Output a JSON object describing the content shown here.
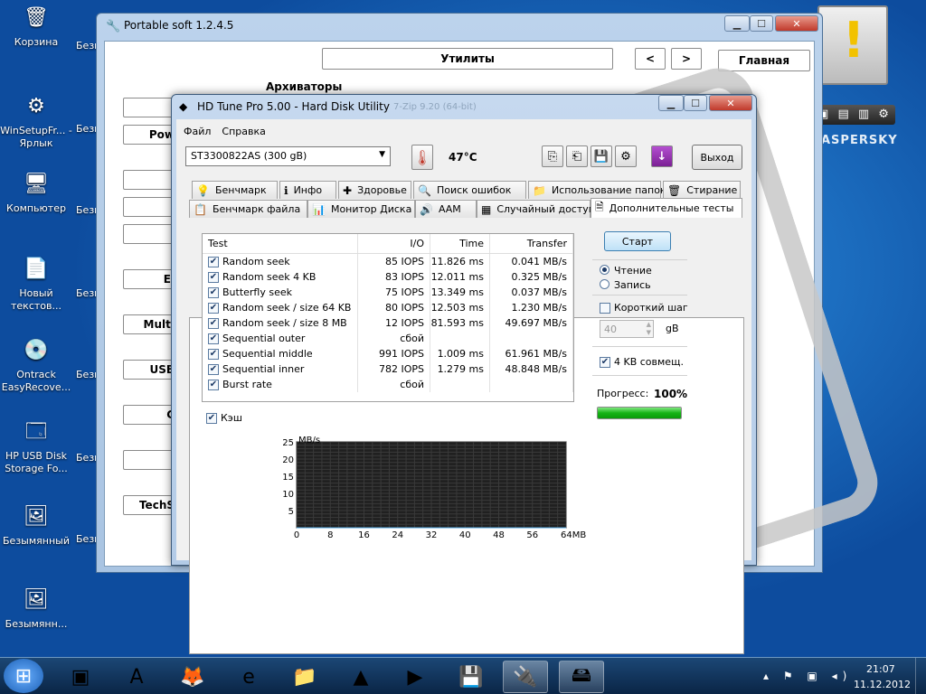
{
  "desktop": {
    "icons": [
      {
        "label": "Корзина",
        "icon": "recycle-bin-icon",
        "glyph": "🗑"
      },
      {
        "label": "WinSetupFr... - Ярлык",
        "icon": "shortcut-icon",
        "glyph": "⚙"
      },
      {
        "label": "Компьютер",
        "icon": "computer-icon",
        "glyph": "🖥"
      },
      {
        "label": "Новый текстов...",
        "icon": "text-file-icon",
        "glyph": "📄"
      },
      {
        "label": "Ontrack EasyRecove...",
        "icon": "recovery-icon",
        "glyph": "💿"
      },
      {
        "label": "HP USB Disk Storage Fo...",
        "icon": "usb-format-icon",
        "glyph": "🗔"
      },
      {
        "label": "Безымянный",
        "icon": "image-file-icon",
        "glyph": "🖼"
      },
      {
        "label": "Безымянн...",
        "icon": "image-file-icon",
        "glyph": "🖼"
      }
    ],
    "cut_labels": [
      "Безы",
      "Безы",
      "Безы",
      "Безы",
      "Безы",
      "Безы",
      "Безы"
    ],
    "kaspersky_text": "ASPERSKY"
  },
  "portable": {
    "title": "Portable soft 1.2.4.5",
    "utilities": "Утилиты",
    "prev": "<",
    "next": ">",
    "home": "Главная",
    "section": "Архиваторы",
    "side_buttons": [
      "",
      "Pow",
      "",
      "",
      "",
      "El",
      "Multi",
      "USB",
      "C",
      "",
      "TechS"
    ]
  },
  "hdtune": {
    "title": "HD Tune Pro 5.00 - Hard Disk Utility",
    "ghost_title": "7-Zip 9.20 (64-bit)",
    "menu": [
      "Файл",
      "Справка"
    ],
    "drive": "ST3300822AS (300 gB)",
    "temperature": "47°C",
    "exit": "Выход",
    "tabs_top": [
      {
        "label": "Бенчмарк",
        "icon": "benchmark-icon",
        "glyph": "💡"
      },
      {
        "label": "Инфо",
        "icon": "info-icon",
        "glyph": "ℹ"
      },
      {
        "label": "Здоровье",
        "icon": "health-icon",
        "glyph": "✚"
      },
      {
        "label": "Поиск ошибок",
        "icon": "error-scan-icon",
        "glyph": "🔍"
      },
      {
        "label": "Использование папок",
        "icon": "folder-usage-icon",
        "glyph": "📁"
      },
      {
        "label": "Стирание",
        "icon": "erase-icon",
        "glyph": "🗑"
      }
    ],
    "tabs_bottom": [
      {
        "label": "Бенчмарк файла",
        "icon": "file-benchmark-icon",
        "glyph": "📋"
      },
      {
        "label": "Монитор Диска",
        "icon": "disk-monitor-icon",
        "glyph": "📊"
      },
      {
        "label": "AAM",
        "icon": "aam-icon",
        "glyph": "🔊"
      },
      {
        "label": "Случайный доступ",
        "icon": "random-access-icon",
        "glyph": "▦"
      },
      {
        "label": "Дополнительные тесты",
        "icon": "extra-tests-icon",
        "glyph": "🗎"
      }
    ],
    "table": {
      "headers": [
        "Test",
        "I/O",
        "Time",
        "Transfer"
      ],
      "rows": [
        {
          "test": "Random seek",
          "io": "85 IOPS",
          "time": "11.826 ms",
          "transfer": "0.041 MB/s"
        },
        {
          "test": "Random seek 4 KB",
          "io": "83 IOPS",
          "time": "12.011 ms",
          "transfer": "0.325 MB/s"
        },
        {
          "test": "Butterfly seek",
          "io": "75 IOPS",
          "time": "13.349 ms",
          "transfer": "0.037 MB/s"
        },
        {
          "test": "Random seek / size 64 KB",
          "io": "80 IOPS",
          "time": "12.503 ms",
          "transfer": "1.230 MB/s"
        },
        {
          "test": "Random seek / size 8 MB",
          "io": "12 IOPS",
          "time": "81.593 ms",
          "transfer": "49.697 MB/s"
        },
        {
          "test": "Sequential outer",
          "io": "сбой",
          "time": "",
          "transfer": ""
        },
        {
          "test": "Sequential middle",
          "io": "991 IOPS",
          "time": "1.009 ms",
          "transfer": "61.961 MB/s"
        },
        {
          "test": "Sequential inner",
          "io": "782 IOPS",
          "time": "1.279 ms",
          "transfer": "48.848 MB/s"
        },
        {
          "test": "Burst rate",
          "io": "сбой",
          "time": "",
          "transfer": ""
        }
      ]
    },
    "cache_label": "Кэш",
    "start": "Старт",
    "read": "Чтение",
    "write": "Запись",
    "short_stroke": "Короткий шаг",
    "short_value": "40",
    "unit_gb": "gB",
    "align_4kb": "4 KB совмещ.",
    "progress_label": "Прогресс:",
    "progress_value": "100%",
    "progress_fraction": 1.0
  },
  "chart_data": {
    "type": "line",
    "ylabel": "MB/s",
    "xlabel": "MB",
    "ylim": [
      0,
      25
    ],
    "xlim": [
      0,
      64
    ],
    "yticks": [
      "25",
      "20",
      "15",
      "10",
      "5"
    ],
    "xticks": [
      "0",
      "8",
      "16",
      "24",
      "32",
      "40",
      "48",
      "56",
      "64MB"
    ],
    "series": [],
    "grid": true
  },
  "taskbar": {
    "items": [
      {
        "icon": "start-orb-icon",
        "glyph": "⊞"
      },
      {
        "icon": "screenshot-tool-icon",
        "glyph": "▣"
      },
      {
        "icon": "autocad-icon",
        "glyph": "A"
      },
      {
        "icon": "firefox-icon",
        "glyph": "🦊"
      },
      {
        "icon": "internet-explorer-icon",
        "glyph": "e"
      },
      {
        "icon": "explorer-folder-icon",
        "glyph": "📁"
      },
      {
        "icon": "vlc-icon",
        "glyph": "▲"
      },
      {
        "icon": "media-player-icon",
        "glyph": "▶"
      },
      {
        "icon": "floppy-icon",
        "glyph": "💾"
      },
      {
        "icon": "usb-drive-icon",
        "glyph": "🔌"
      },
      {
        "icon": "hard-disk-icon",
        "glyph": "🖴"
      }
    ],
    "time": "21:07",
    "date": "11.12.2012"
  }
}
